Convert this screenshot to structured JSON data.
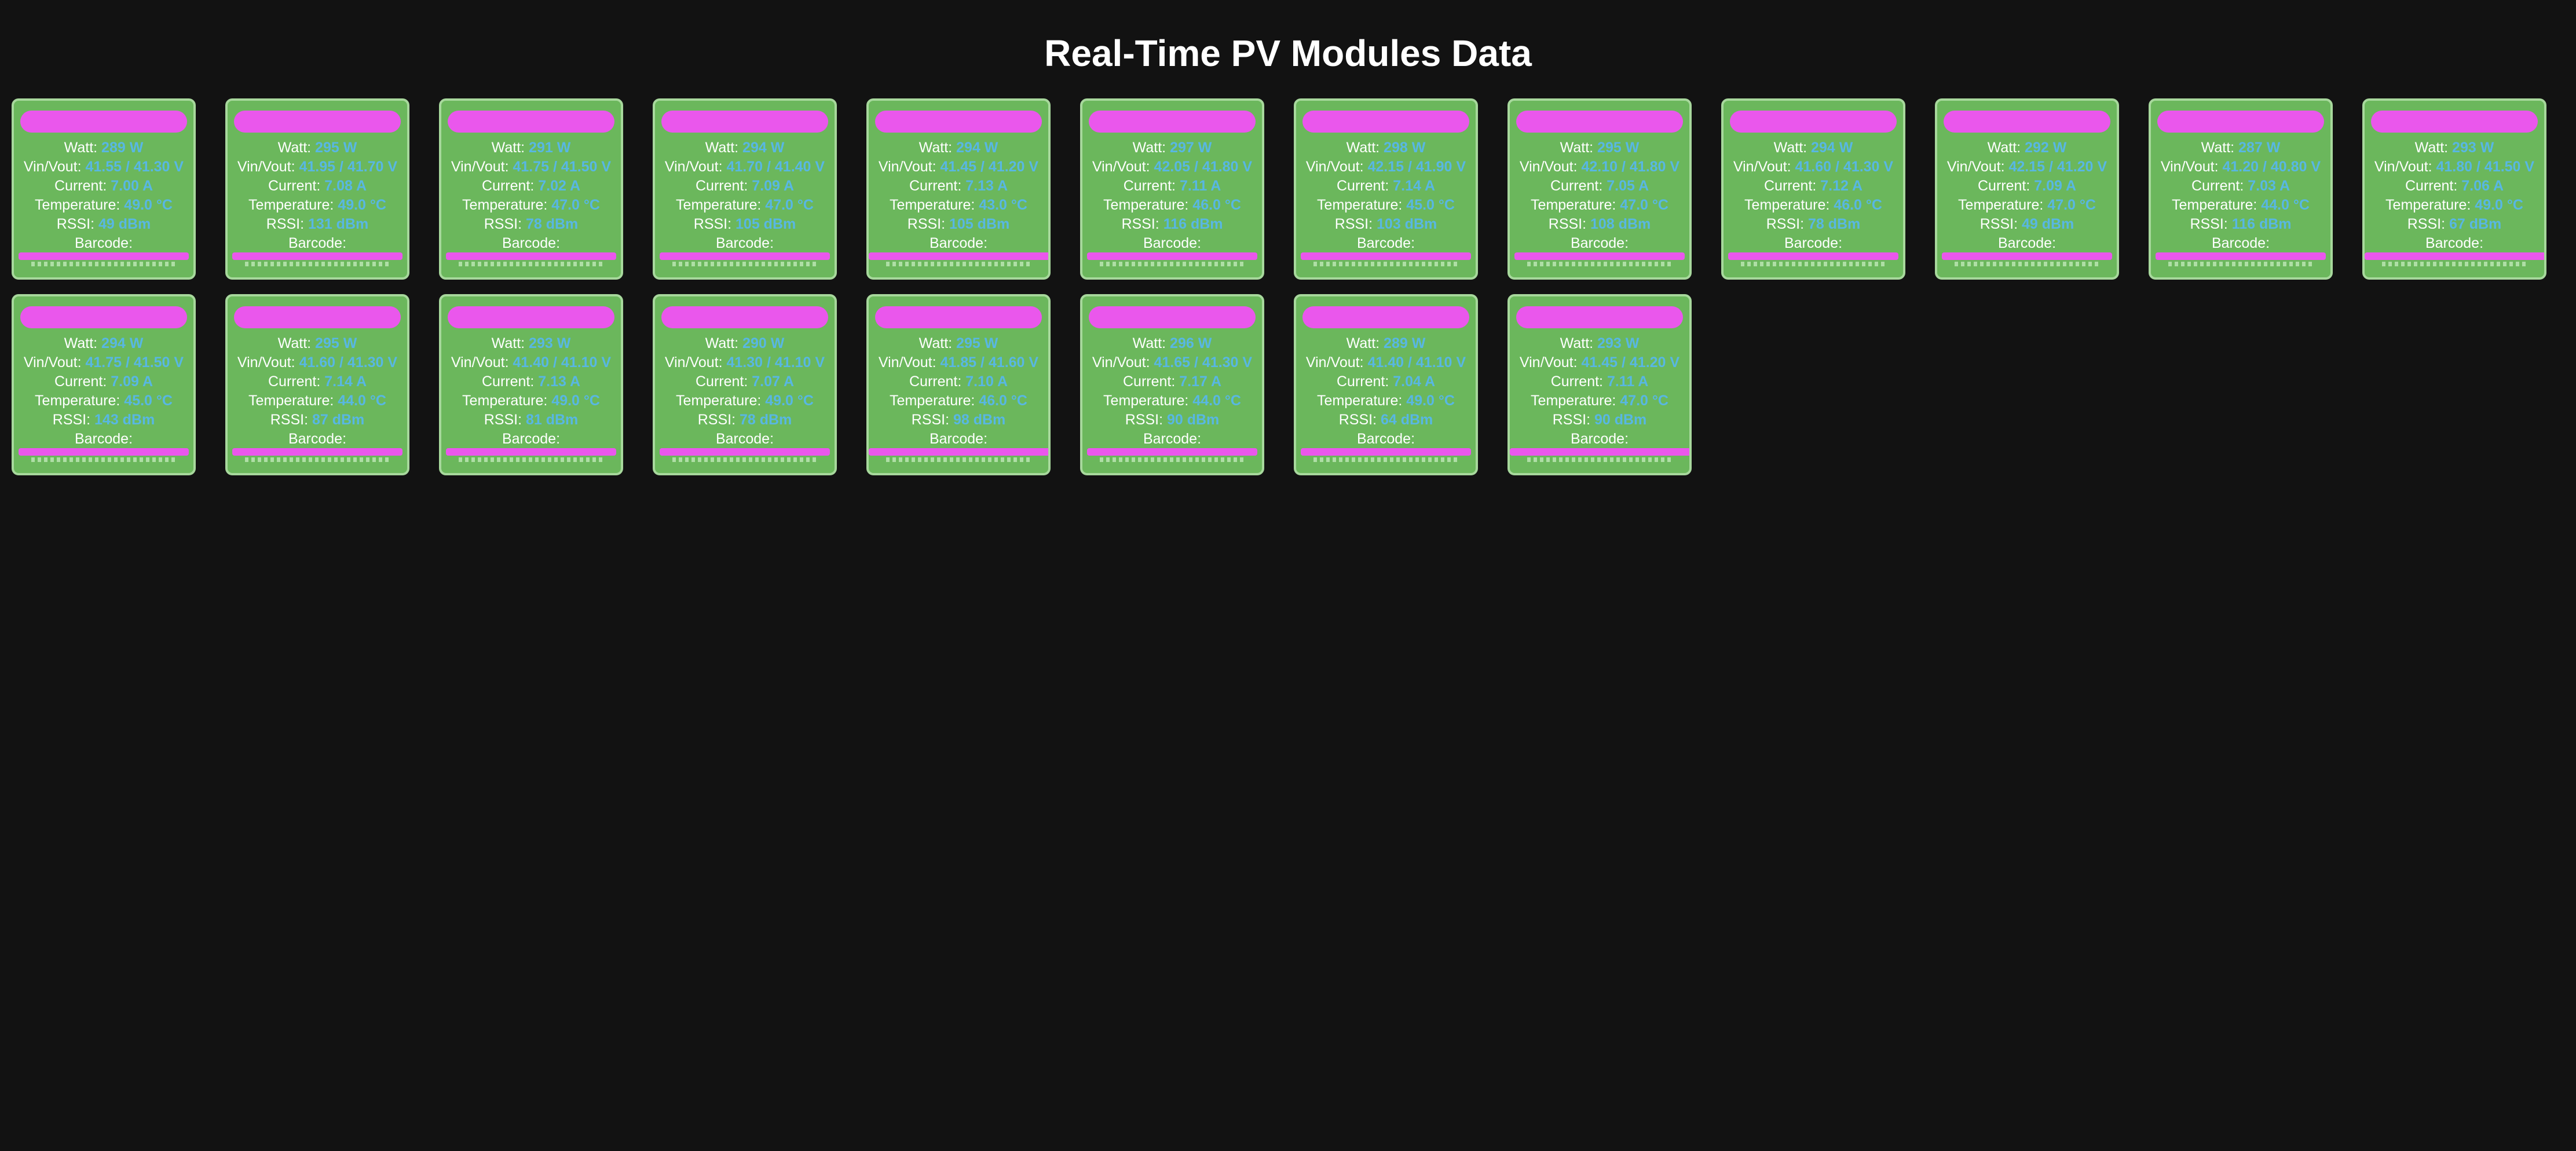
{
  "page": {
    "title": "Real-Time PV Modules Data"
  },
  "labels": {
    "watt": "Watt:",
    "vinvout": "Vin/Vout:",
    "current": "Current:",
    "temperature": "Temperature:",
    "rssi": "RSSI:",
    "barcode": "Barcode:"
  },
  "colors": {
    "background": "#121212",
    "card": "#6bb75c",
    "card_border": "#a7d89c",
    "highlight_bar": "#ea57ec",
    "value_text": "#58b7e3"
  },
  "modules": [
    {
      "watt": "289 W",
      "vinvout": "41.55 / 41.30 V",
      "current": "7.00 A",
      "temperature": "49.0 °C",
      "rssi": "49 dBm"
    },
    {
      "watt": "295 W",
      "vinvout": "41.95 / 41.70 V",
      "current": "7.08 A",
      "temperature": "49.0 °C",
      "rssi": "131 dBm"
    },
    {
      "watt": "291 W",
      "vinvout": "41.75 / 41.50 V",
      "current": "7.02 A",
      "temperature": "47.0 °C",
      "rssi": "78 dBm"
    },
    {
      "watt": "294 W",
      "vinvout": "41.70 / 41.40 V",
      "current": "7.09 A",
      "temperature": "47.0 °C",
      "rssi": "105 dBm"
    },
    {
      "watt": "294 W",
      "vinvout": "41.45 / 41.20 V",
      "current": "7.13 A",
      "temperature": "43.0 °C",
      "rssi": "105 dBm"
    },
    {
      "watt": "297 W",
      "vinvout": "42.05 / 41.80 V",
      "current": "7.11 A",
      "temperature": "46.0 °C",
      "rssi": "116 dBm"
    },
    {
      "watt": "298 W",
      "vinvout": "42.15 / 41.90 V",
      "current": "7.14 A",
      "temperature": "45.0 °C",
      "rssi": "103 dBm"
    },
    {
      "watt": "295 W",
      "vinvout": "42.10 / 41.80 V",
      "current": "7.05 A",
      "temperature": "47.0 °C",
      "rssi": "108 dBm"
    },
    {
      "watt": "294 W",
      "vinvout": "41.60 / 41.30 V",
      "current": "7.12 A",
      "temperature": "46.0 °C",
      "rssi": "78 dBm"
    },
    {
      "watt": "292 W",
      "vinvout": "42.15 / 41.20 V",
      "current": "7.09 A",
      "temperature": "47.0 °C",
      "rssi": "49 dBm"
    },
    {
      "watt": "287 W",
      "vinvout": "41.20 / 40.80 V",
      "current": "7.03 A",
      "temperature": "44.0 °C",
      "rssi": "116 dBm"
    },
    {
      "watt": "293 W",
      "vinvout": "41.80 / 41.50 V",
      "current": "7.06 A",
      "temperature": "49.0 °C",
      "rssi": "67 dBm"
    },
    {
      "watt": "294 W",
      "vinvout": "41.75 / 41.50 V",
      "current": "7.09 A",
      "temperature": "45.0 °C",
      "rssi": "143 dBm"
    },
    {
      "watt": "295 W",
      "vinvout": "41.60 / 41.30 V",
      "current": "7.14 A",
      "temperature": "44.0 °C",
      "rssi": "87 dBm"
    },
    {
      "watt": "293 W",
      "vinvout": "41.40 / 41.10 V",
      "current": "7.13 A",
      "temperature": "49.0 °C",
      "rssi": "81 dBm"
    },
    {
      "watt": "290 W",
      "vinvout": "41.30 / 41.10 V",
      "current": "7.07 A",
      "temperature": "49.0 °C",
      "rssi": "78 dBm"
    },
    {
      "watt": "295 W",
      "vinvout": "41.85 / 41.60 V",
      "current": "7.10 A",
      "temperature": "46.0 °C",
      "rssi": "98 dBm"
    },
    {
      "watt": "296 W",
      "vinvout": "41.65 / 41.30 V",
      "current": "7.17 A",
      "temperature": "44.0 °C",
      "rssi": "90 dBm"
    },
    {
      "watt": "289 W",
      "vinvout": "41.40 / 41.10 V",
      "current": "7.04 A",
      "temperature": "49.0 °C",
      "rssi": "64 dBm"
    },
    {
      "watt": "293 W",
      "vinvout": "41.45 / 41.20 V",
      "current": "7.11 A",
      "temperature": "47.0 °C",
      "rssi": "90 dBm"
    }
  ]
}
